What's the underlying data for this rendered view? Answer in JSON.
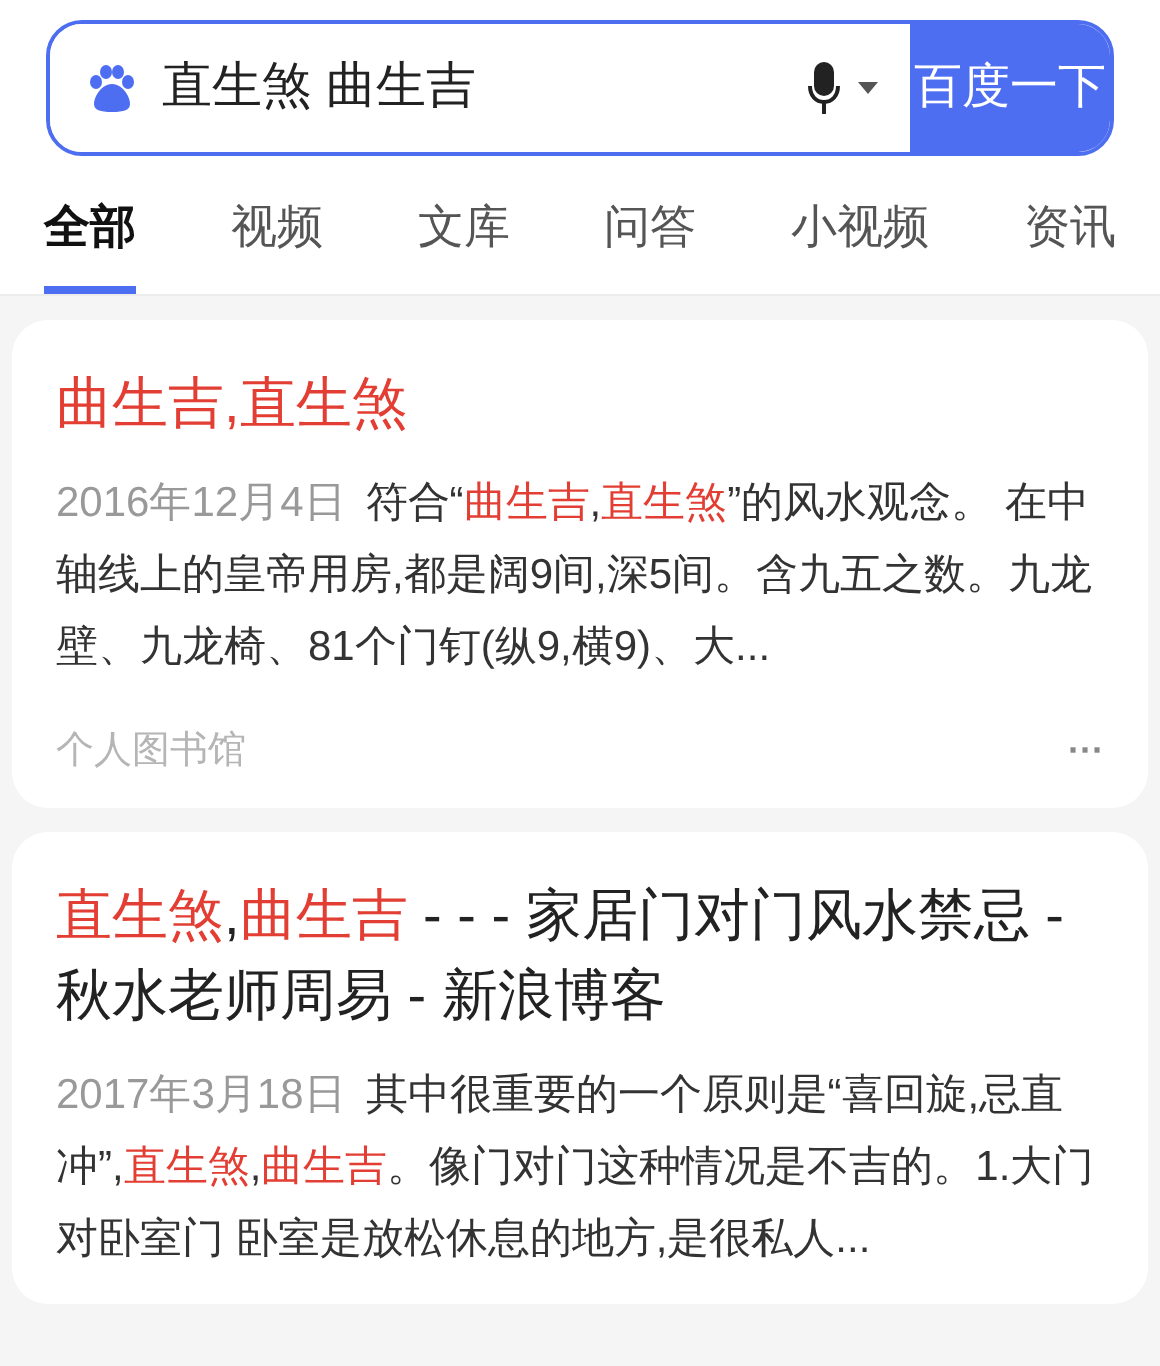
{
  "search": {
    "value": "直生煞 曲生吉",
    "button": "百度一下"
  },
  "tabs": [
    {
      "label": "全部",
      "selected": true
    },
    {
      "label": "视频",
      "selected": false
    },
    {
      "label": "文库",
      "selected": false
    },
    {
      "label": "问答",
      "selected": false
    },
    {
      "label": "小视频",
      "selected": false
    },
    {
      "label": "资讯",
      "selected": false
    }
  ],
  "results": [
    {
      "title": [
        {
          "text": "曲生吉,直生煞",
          "highlight": true
        }
      ],
      "date": "2016年12月4日",
      "snippet": [
        {
          "text": "符合“",
          "highlight": false
        },
        {
          "text": "曲生吉",
          "highlight": true
        },
        {
          "text": ",",
          "highlight": false
        },
        {
          "text": "直生煞",
          "highlight": true
        },
        {
          "text": "”的风水观念。 在中轴线上的皇帝用房,都是阔9间,深5间。含九五之数。九龙壁、九龙椅、81个门钉(纵9,横9)、大...",
          "highlight": false
        }
      ],
      "source": "个人图书馆",
      "more": "···"
    },
    {
      "title": [
        {
          "text": "直生煞",
          "highlight": true
        },
        {
          "text": ",",
          "highlight": false
        },
        {
          "text": "曲生吉",
          "highlight": true
        },
        {
          "text": " - - - 家居门对门风水禁忌 - 秋水老师周易 - 新浪博客",
          "highlight": false
        }
      ],
      "date": "2017年3月18日",
      "snippet": [
        {
          "text": "其中很重要的一个原则是“喜回旋,忌直冲”,",
          "highlight": false
        },
        {
          "text": "直生煞",
          "highlight": true
        },
        {
          "text": ",",
          "highlight": false
        },
        {
          "text": "曲生吉",
          "highlight": true
        },
        {
          "text": "。像门对门这种情况是不吉的。1.大门对卧室门 卧室是放松休息的地方,是很私人...",
          "highlight": false
        }
      ]
    }
  ]
}
